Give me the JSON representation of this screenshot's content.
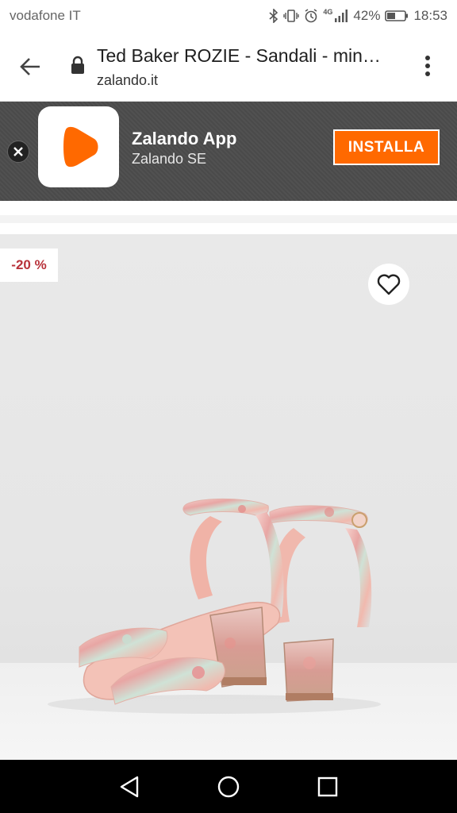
{
  "status": {
    "carrier": "vodafone IT",
    "network": "4G",
    "battery": "42%",
    "time": "18:53"
  },
  "browser": {
    "title": "Ted Baker ROZIE - Sandali - min…",
    "url": "zalando.it"
  },
  "banner": {
    "app_name": "Zalando App",
    "publisher": "Zalando SE",
    "install_label": "INSTALLA"
  },
  "product": {
    "discount": "-20 %"
  },
  "colors": {
    "brand_orange": "#ff6900",
    "discount_red": "#b8323a",
    "banner_bg": "#4a4a4a"
  },
  "icons": {
    "back": "arrow-left-icon",
    "lock": "lock-icon",
    "menu": "more-vert-icon",
    "close": "close-icon",
    "wishlist": "heart-outline-icon",
    "nav_back": "triangle-back-icon",
    "nav_home": "circle-home-icon",
    "nav_recents": "square-recents-icon"
  }
}
